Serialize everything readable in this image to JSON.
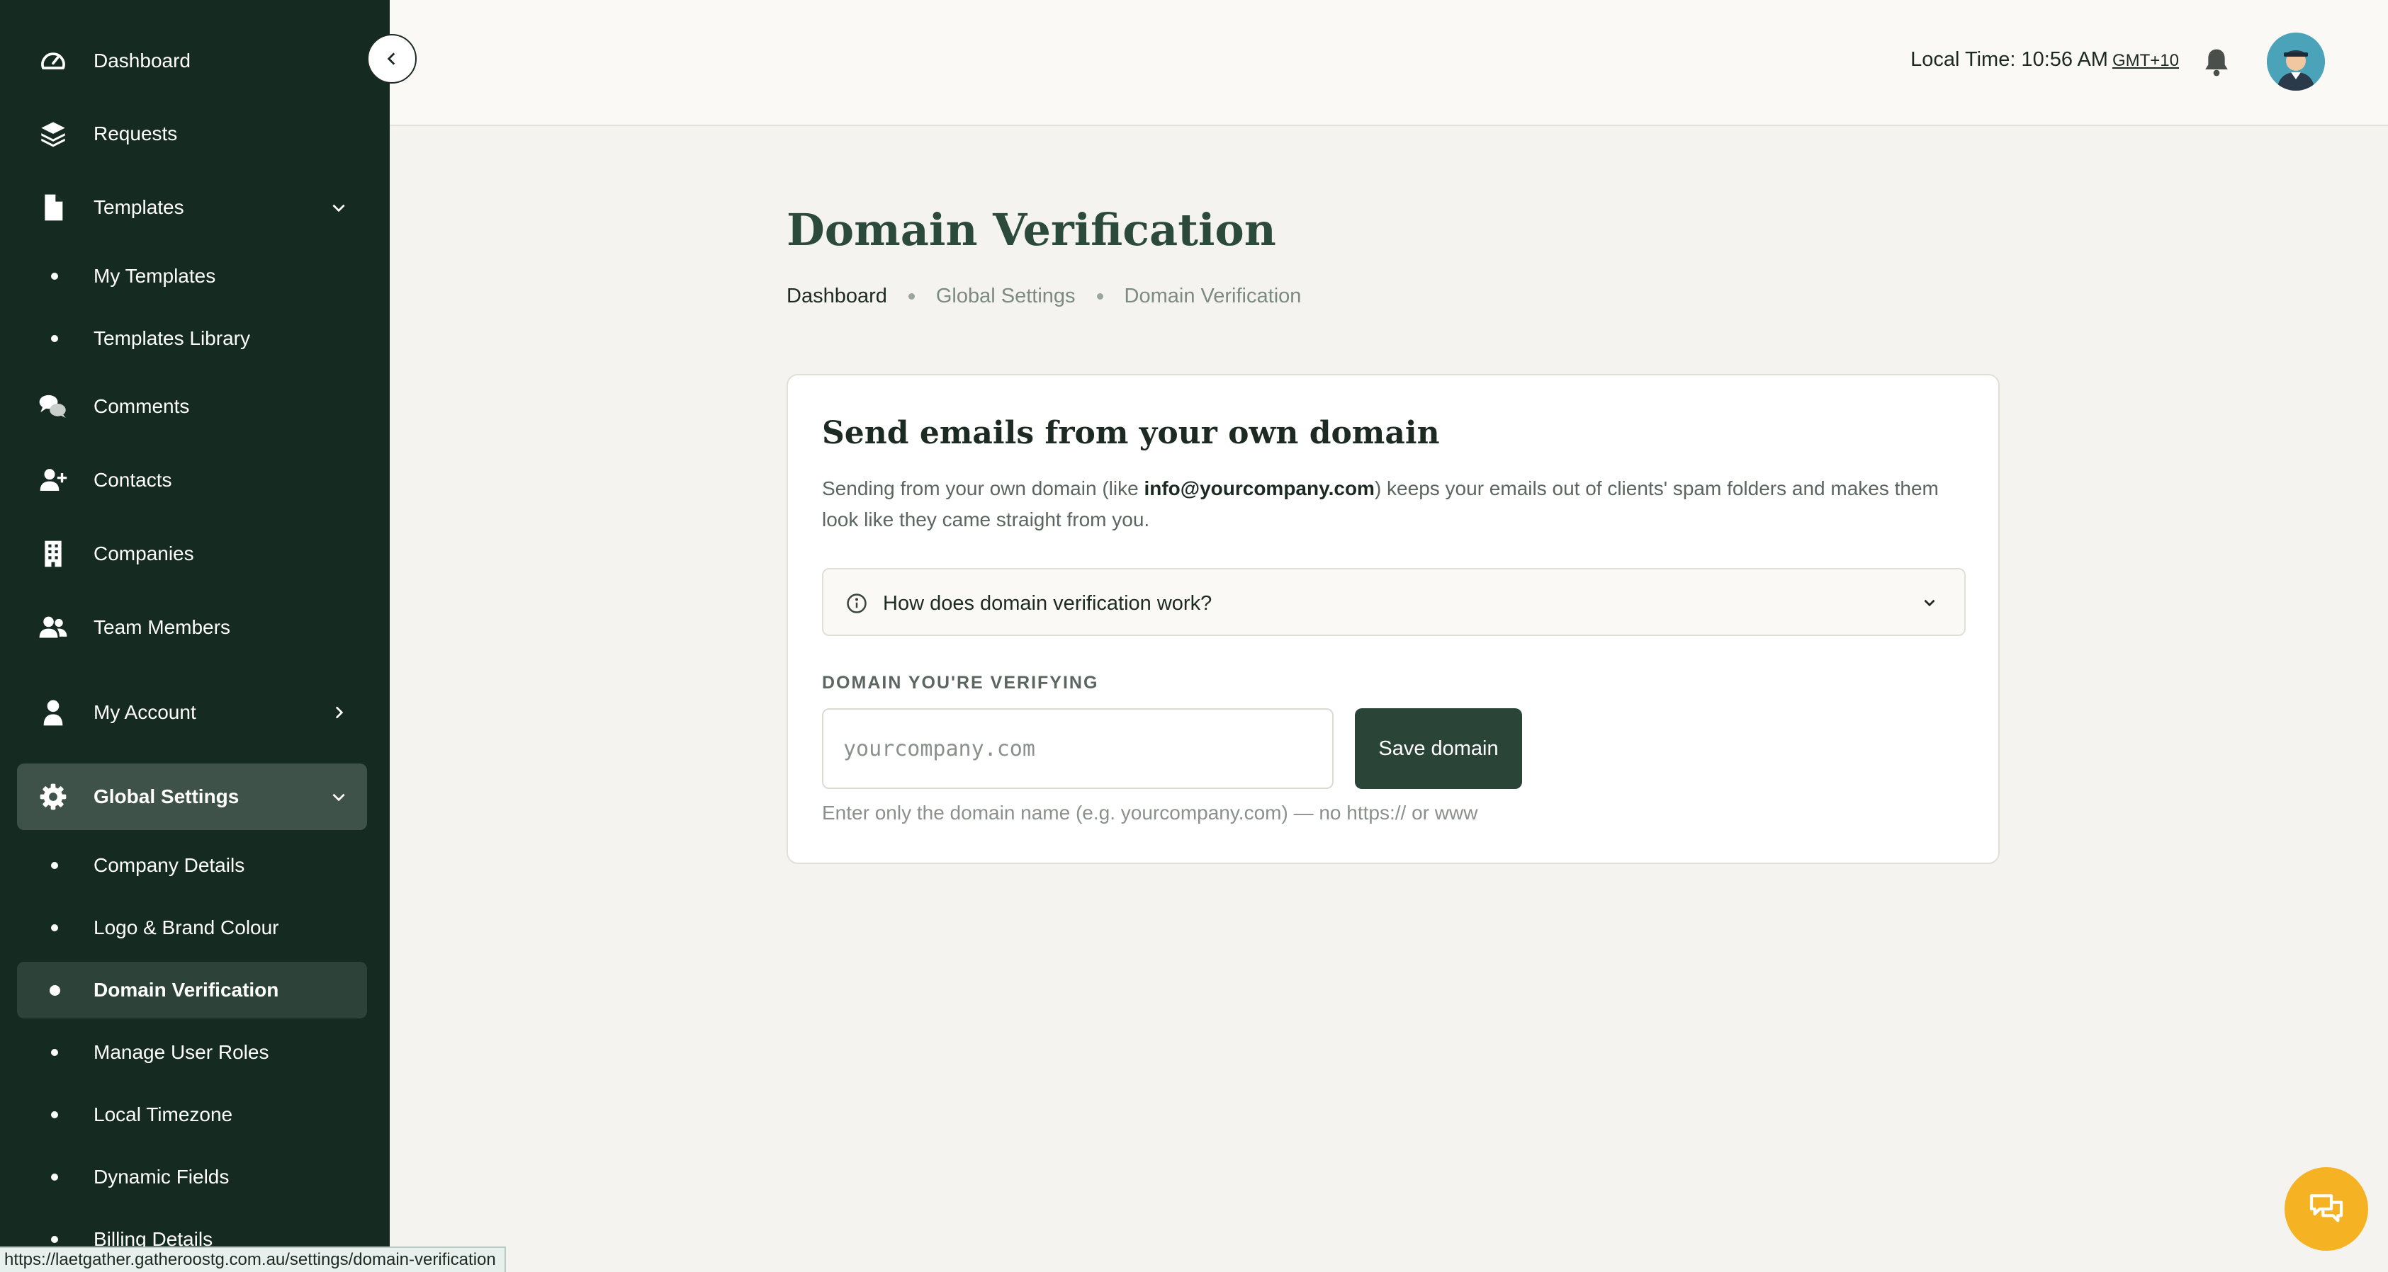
{
  "sidebar": {
    "items": [
      {
        "label": "Dashboard",
        "icon": "dashboard-gauge-icon"
      },
      {
        "label": "Requests",
        "icon": "layers-icon"
      },
      {
        "label": "Templates",
        "icon": "file-icon"
      },
      {
        "label": "Comments",
        "icon": "comments-icon"
      },
      {
        "label": "Contacts",
        "icon": "user-plus-icon"
      },
      {
        "label": "Companies",
        "icon": "building-icon"
      },
      {
        "label": "Team Members",
        "icon": "users-icon"
      },
      {
        "label": "My Account",
        "icon": "user-icon"
      },
      {
        "label": "Global Settings",
        "icon": "gear-icon"
      }
    ],
    "templates_sub": [
      "My Templates",
      "Templates Library"
    ],
    "settings_sub": [
      "Company Details",
      "Logo & Brand Colour",
      "Domain Verification",
      "Manage User Roles",
      "Local Timezone",
      "Dynamic Fields",
      "Billing Details"
    ],
    "active_sub": "Domain Verification"
  },
  "topbar": {
    "local_time_label": "Local Time: 10:56 AM",
    "timezone": "GMT+10"
  },
  "page": {
    "title": "Domain Verification",
    "breadcrumb": [
      "Dashboard",
      "Global Settings",
      "Domain Verification"
    ]
  },
  "card": {
    "title": "Send emails from your own domain",
    "desc_before": "Sending from your own domain (like ",
    "desc_email": "info@yourcompany.com",
    "desc_after": ") keeps your emails out of clients' spam folders and makes them look like they came straight from you.",
    "accordion_label": "How does domain verification work?",
    "field_label": "DOMAIN YOU'RE VERIFYING",
    "input_placeholder": "yourcompany.com",
    "input_value": "",
    "save_label": "Save domain",
    "helper": "Enter only the domain name (e.g. yourcompany.com) — no https:// or www"
  },
  "status_url": "https://laetgather.gatheroostg.com.au/settings/domain-verification",
  "colors": {
    "sidebar_bg": "#152a21",
    "active_bg": "#3f5249",
    "primary_button": "#2a4438",
    "title_green": "#2c4a3c",
    "chat_fab": "#f5b324",
    "page_bg": "#f4f3ef"
  }
}
